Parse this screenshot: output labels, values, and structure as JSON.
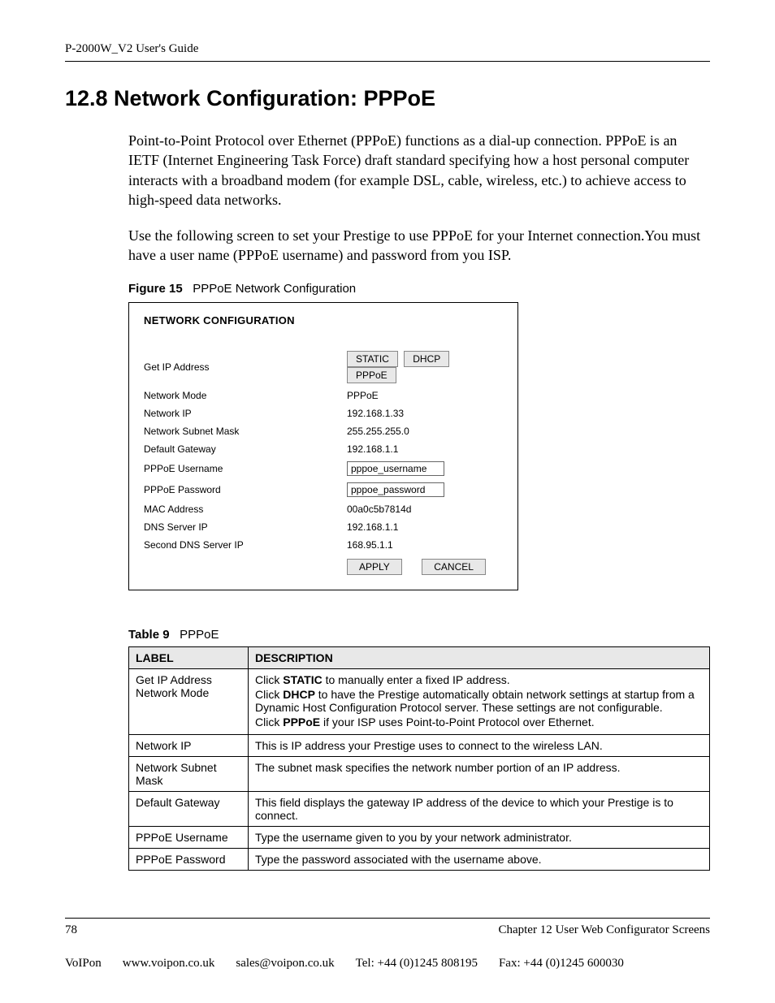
{
  "header": {
    "running_head": "P-2000W_V2 User's Guide"
  },
  "section": {
    "title": "12.8  Network Configuration: PPPoE",
    "para1": "Point-to-Point Protocol over Ethernet (PPPoE) functions as a dial-up connection. PPPoE is an IETF (Internet Engineering Task Force) draft standard specifying how a host personal computer interacts with a broadband modem (for example DSL, cable, wireless, etc.) to achieve access to high-speed data networks.",
    "para2": "Use the following screen to set your Prestige to use PPPoE for your Internet connection.You must have a user name (PPPoE username) and password from you ISP."
  },
  "figure": {
    "label": "Figure 15",
    "title": "PPPoE Network Configuration",
    "panel_title": "NETWORK CONFIGURATION",
    "rows": {
      "get_ip_label": "Get IP Address",
      "buttons": {
        "static": "STATIC",
        "dhcp": "DHCP",
        "pppoe": "PPPoE"
      },
      "mode_label": "Network Mode",
      "mode_value": "PPPoE",
      "ip_label": "Network IP",
      "ip_value": "192.168.1.33",
      "mask_label": "Network Subnet Mask",
      "mask_value": "255.255.255.0",
      "gw_label": "Default Gateway",
      "gw_value": "192.168.1.1",
      "user_label": "PPPoE Username",
      "user_value": "pppoe_username",
      "pass_label": "PPPoE Password",
      "pass_value": "pppoe_password",
      "mac_label": "MAC Address",
      "mac_value": "00a0c5b7814d",
      "dns_label": "DNS Server IP",
      "dns_value": "192.168.1.1",
      "dns2_label": "Second DNS Server IP",
      "dns2_value": "168.95.1.1",
      "apply": "APPLY",
      "cancel": "CANCEL"
    }
  },
  "table": {
    "label": "Table 9",
    "title": "PPPoE",
    "head_label": "LABEL",
    "head_desc": "DESCRIPTION",
    "rows": [
      {
        "label": "Get IP Address Network Mode",
        "desc_parts": [
          {
            "pre": "Click ",
            "bold": "STATIC",
            "post": " to manually enter a fixed IP address."
          },
          {
            "pre": "Click ",
            "bold": "DHCP",
            "post": " to have the Prestige automatically obtain network settings at startup from a Dynamic Host Configuration Protocol server. These settings are not configurable."
          },
          {
            "pre": "Click ",
            "bold": "PPPoE",
            "post": " if your ISP uses Point-to-Point Protocol over Ethernet."
          }
        ]
      },
      {
        "label": "Network IP",
        "desc": "This is IP address your Prestige uses to connect to the wireless LAN."
      },
      {
        "label": "Network Subnet Mask",
        "desc": "The subnet mask specifies the network number portion of an IP address."
      },
      {
        "label": "Default Gateway",
        "desc": "This field displays the gateway IP address of the device to which your Prestige is to connect."
      },
      {
        "label": "PPPoE Username",
        "desc": "Type the username given to you by your network administrator."
      },
      {
        "label": "PPPoE Password",
        "desc": "Type the password associated with the username above."
      }
    ]
  },
  "footer": {
    "page_no": "78",
    "chapter": "Chapter 12 User Web Configurator Screens",
    "company": "VoIPon",
    "web": "www.voipon.co.uk",
    "email": "sales@voipon.co.uk",
    "tel": "Tel: +44 (0)1245 808195",
    "fax": "Fax: +44 (0)1245 600030"
  }
}
